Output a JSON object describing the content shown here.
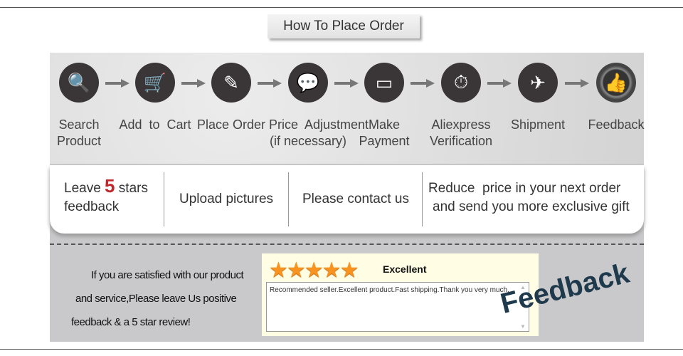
{
  "title": "How To Place Order",
  "steps": [
    {
      "icon": "search-icon",
      "glyph": "🔍",
      "label1": "Search",
      "label2": "Product"
    },
    {
      "icon": "cart-icon",
      "glyph": "🛒",
      "label1": "Add  to  Cart",
      "label2": ""
    },
    {
      "icon": "edit-icon",
      "glyph": "✎",
      "label1": "Place Order",
      "label2": ""
    },
    {
      "icon": "chat-icon",
      "glyph": "💬",
      "label1": "Price  Adjustment",
      "label2": "(if necessary)"
    },
    {
      "icon": "credit-card-icon",
      "glyph": "▭",
      "label1": "Make",
      "label2": "Payment"
    },
    {
      "icon": "clock-24-icon",
      "glyph": "⏱",
      "label1": "Aliexpress",
      "label2": "Verification"
    },
    {
      "icon": "airplane-icon",
      "glyph": "✈",
      "label1": "Shipment",
      "label2": ""
    },
    {
      "icon": "thumbs-up-icon",
      "glyph": "👍",
      "label1": "Feedback",
      "label2": ""
    }
  ],
  "strip": {
    "c1a": "Leave ",
    "c1num": "5",
    "c1b": " stars",
    "c1c": "feedback",
    "c2": "Upload pictures",
    "c3": "Please contact us",
    "c4a": "Reduce  price in your next order",
    "c4b": "and send you more exclusive gift"
  },
  "message": [
    "If you are satisfied with our product",
    "and service,Please leave Us positive",
    "feedback & a 5 star review!"
  ],
  "review": {
    "stars": "★★★★★",
    "rating": 5,
    "rating_label": "Excellent",
    "text": "Recommended seller.Excellent product.Fast shipping.Thank you very much."
  },
  "feedback_word": "Feedback",
  "colors": {
    "accent_number": "#c0282d",
    "star": "#f7931e",
    "feedback_text": "#1e3a4c"
  }
}
